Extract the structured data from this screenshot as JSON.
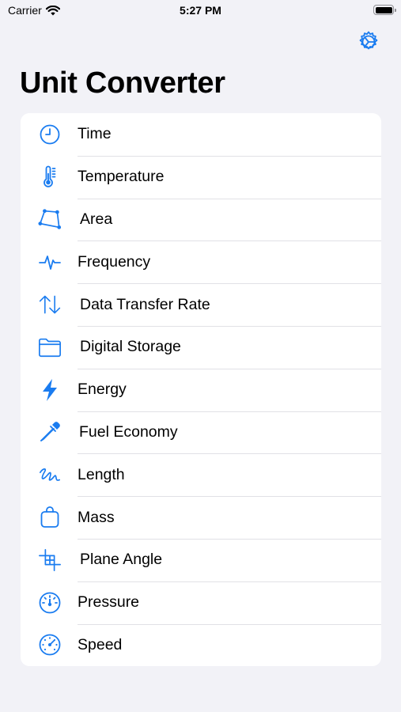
{
  "status_bar": {
    "carrier": "Carrier",
    "time": "5:27 PM"
  },
  "header": {
    "title": "Unit Converter",
    "settings_icon": "gear-icon"
  },
  "colors": {
    "accent": "#1a7cf0",
    "background": "#f2f2f7",
    "card": "#ffffff"
  },
  "categories": [
    {
      "label": "Time",
      "icon": "clock-icon"
    },
    {
      "label": "Temperature",
      "icon": "thermometer-icon"
    },
    {
      "label": "Area",
      "icon": "polygon-icon"
    },
    {
      "label": "Frequency",
      "icon": "waveform-icon"
    },
    {
      "label": "Data Transfer Rate",
      "icon": "arrows-up-down-icon"
    },
    {
      "label": "Digital Storage",
      "icon": "folder-icon"
    },
    {
      "label": "Energy",
      "icon": "bolt-icon"
    },
    {
      "label": "Fuel Economy",
      "icon": "eyedropper-icon"
    },
    {
      "label": "Length",
      "icon": "scribble-icon"
    },
    {
      "label": "Mass",
      "icon": "bag-icon"
    },
    {
      "label": "Plane Angle",
      "icon": "crop-angle-icon"
    },
    {
      "label": "Pressure",
      "icon": "gauge-icon"
    },
    {
      "label": "Speed",
      "icon": "speedometer-icon"
    }
  ]
}
